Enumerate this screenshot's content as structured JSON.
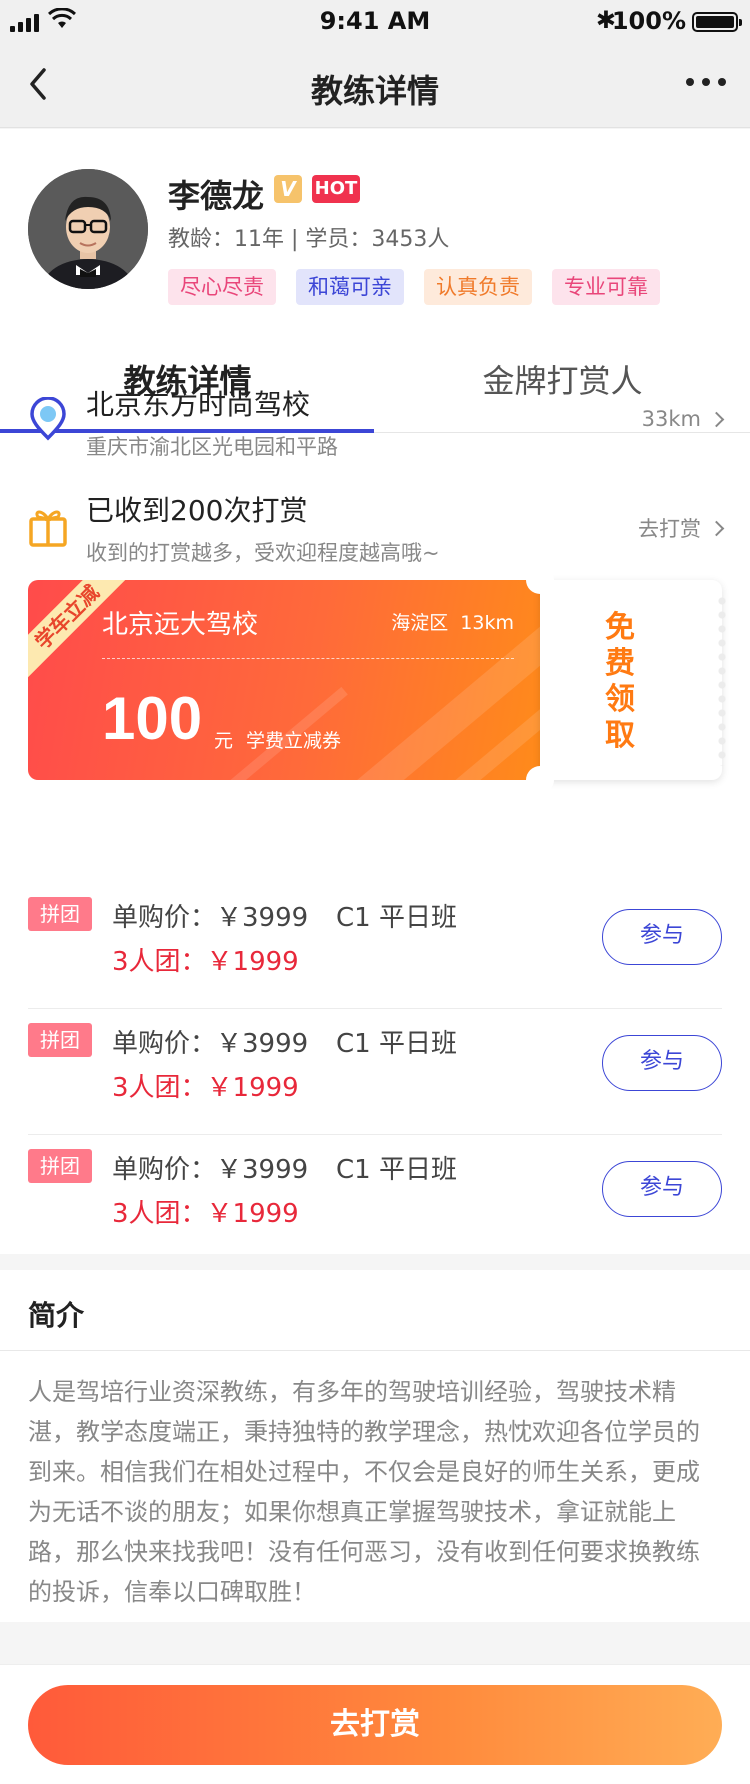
{
  "status_bar": {
    "time": "9:41 AM",
    "battery": "100%",
    "bluetooth_glyph": "✱"
  },
  "nav": {
    "title": "教练详情"
  },
  "coach": {
    "name": "李德龙",
    "verified_badge": "V",
    "hot_badge": "HOT",
    "meta": "教龄：11年 | 学员：3453人",
    "tags": [
      {
        "label": "尽心尽责",
        "bg": "#fde3ec",
        "color": "#e9467a"
      },
      {
        "label": "和蔼可亲",
        "bg": "#e2e4fb",
        "color": "#3c46d6"
      },
      {
        "label": "认真负责",
        "bg": "#feeadb",
        "color": "#f07a2a"
      },
      {
        "label": "专业可靠",
        "bg": "#fde3ec",
        "color": "#e9467a"
      }
    ]
  },
  "tabs": [
    {
      "label": "教练详情",
      "active": true
    },
    {
      "label": "金牌打赏人",
      "active": false
    }
  ],
  "school_row": {
    "title": "北京东方时尚驾校",
    "address": "重庆市渝北区光电园和平路",
    "distance": "33km",
    "icon": "location-pin-icon"
  },
  "reward_row": {
    "title": "已收到200次打赏",
    "subtitle": "收到的打赏越多，受欢迎程度越高哦~",
    "action": "去打赏",
    "icon": "gift-icon"
  },
  "coupon": {
    "ribbon": "学车立减",
    "school": "北京远大驾校",
    "district": "海淀区",
    "distance": "13km",
    "amount": "100",
    "unit": "元",
    "desc": "学费立减券",
    "free_label": "免费领取",
    "colors": {
      "from": "#ff4b4b",
      "to": "#ff8b1a",
      "accent": "#ff7a12"
    }
  },
  "groups": [
    {
      "badge": "拼团",
      "single_price": "单购价：￥3999",
      "class_name": "C1 平日班",
      "team_price": "3人团：￥1999",
      "button": "参与"
    },
    {
      "badge": "拼团",
      "single_price": "单购价：￥3999",
      "class_name": "C1 平日班",
      "team_price": "3人团：￥1999",
      "button": "参与"
    },
    {
      "badge": "拼团",
      "single_price": "单购价：￥3999",
      "class_name": "C1 平日班",
      "team_price": "3人团：￥1999",
      "button": "参与"
    }
  ],
  "intro": {
    "title": "简介",
    "text": "人是驾培行业资深教练，有多年的驾驶培训经验，驾驶技术精湛，教学态度端正，秉持独特的教学理念，热忱欢迎各位学员的到来。相信我们在相处过程中，不仅会是良好的师生关系，更成为无话不谈的朋友；如果你想真正掌握驾驶技术，拿证就能上路，那么快来找我吧！没有任何恶习，没有收到任何要求换教练的投诉，信奉以口碑取胜！"
  },
  "cta": {
    "label": "去打赏"
  },
  "theme": {
    "primary": "#3c46d6",
    "price_red": "#e8283a"
  }
}
